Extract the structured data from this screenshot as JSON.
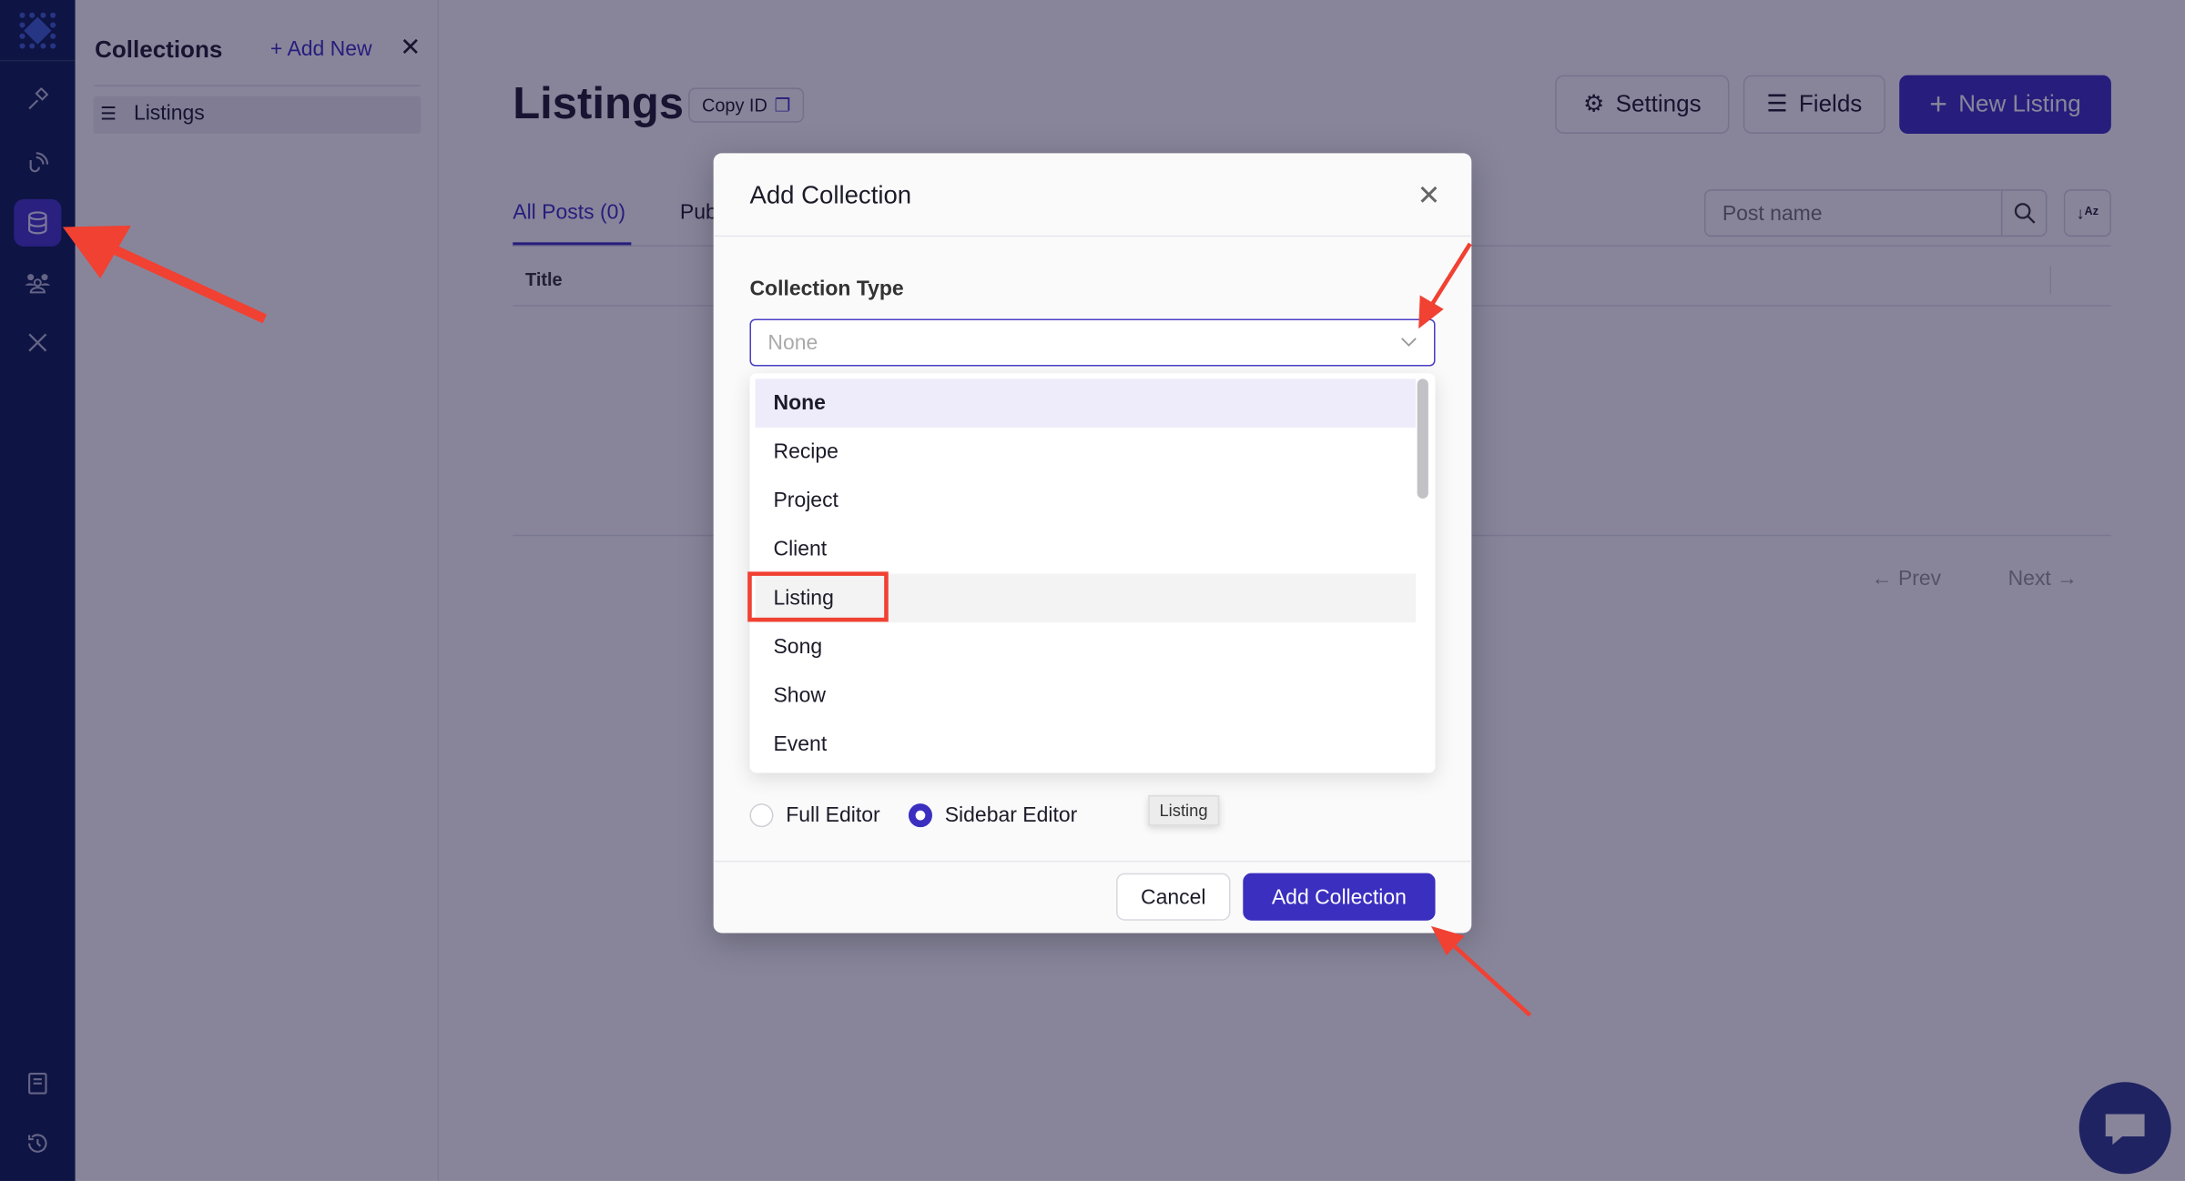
{
  "rail": {
    "items": [
      "logo-icon",
      "hammer-icon",
      "signal-icon",
      "database-icon",
      "users-icon",
      "tools-icon",
      "book-icon",
      "history-icon"
    ],
    "active": "database-icon"
  },
  "collections_panel": {
    "title": "Collections",
    "add_new": "+ Add New",
    "items": [
      {
        "label": "Listings"
      }
    ]
  },
  "main": {
    "title": "Listings",
    "copy_id": "Copy ID",
    "buttons": {
      "settings": "Settings",
      "fields": "Fields",
      "new_listing": "New Listing"
    },
    "tabs": [
      {
        "label": "All Posts (0)",
        "active": true
      },
      {
        "label": "Pub"
      }
    ],
    "search": {
      "placeholder": "Post name"
    },
    "table": {
      "columns": [
        "Title"
      ]
    },
    "pagination": {
      "prev": "Prev",
      "next": "Next"
    }
  },
  "modal": {
    "title": "Add Collection",
    "field_label": "Collection Type",
    "select": {
      "placeholder": "None"
    },
    "options": [
      "None",
      "Recipe",
      "Project",
      "Client",
      "Listing",
      "Song",
      "Show",
      "Event"
    ],
    "selected_option": "None",
    "hovered_option": "Listing",
    "editor": {
      "options": [
        "Full Editor",
        "Sidebar Editor"
      ],
      "selected": "Sidebar Editor"
    },
    "tooltip": "Listing",
    "cancel": "Cancel",
    "submit": "Add Collection"
  },
  "colors": {
    "accent": "#3b2fc0",
    "rail": "#0b1d4f",
    "annotation": "#f04133"
  }
}
